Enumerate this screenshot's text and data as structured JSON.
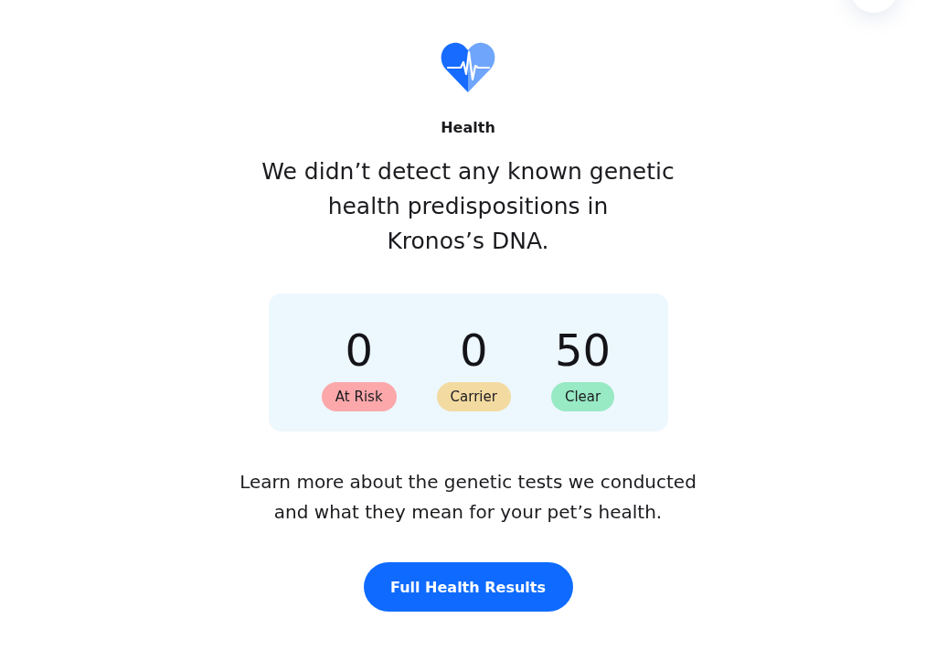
{
  "section": {
    "title": "Health",
    "headline": "We didn’t detect any known genetic health predispositions in Kronos’s DNA."
  },
  "summary": [
    {
      "count": "0",
      "label": "At Risk",
      "color": "#fca8ab"
    },
    {
      "count": "0",
      "label": "Carrier",
      "color": "#f3daa1"
    },
    {
      "count": "50",
      "label": "Clear",
      "color": "#97eac4"
    }
  ],
  "description": "Learn more about the genetic tests we conducted and what they mean for your pet’s health.",
  "button": {
    "label": "Full Health Results"
  }
}
